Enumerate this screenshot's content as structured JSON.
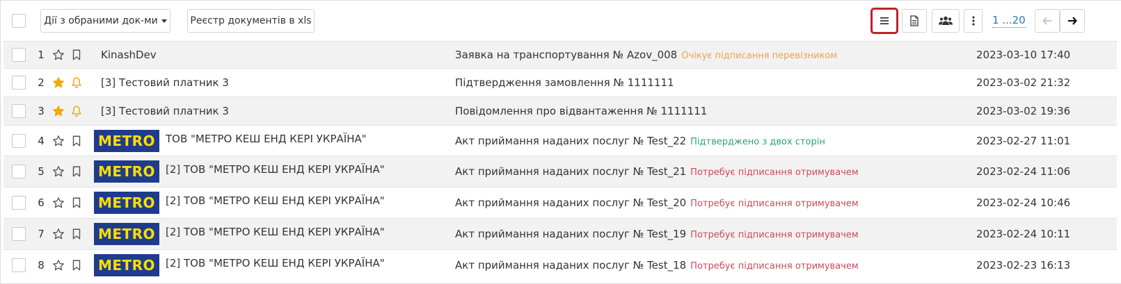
{
  "toolbar": {
    "bulk_actions_label": "Дії з обраними док-ми",
    "export_label": "Реєстр документів в xls",
    "pagination_label": "1 ...20"
  },
  "colors": {
    "status_pending": "#f0a24a",
    "status_confirmed": "#27a86f",
    "status_needs_sign": "#cc4a5a",
    "star_active": "#f2a900",
    "active_button_outline": "#c0202e",
    "link": "#2a7ab8",
    "metro_blue": "#1f3c8c",
    "metro_yellow": "#ffde00"
  },
  "rows": [
    {
      "num": "1",
      "starred": false,
      "bell": false,
      "logo": false,
      "sender": "KinashDev",
      "doc": "Заявка на транспортування № Azov_008",
      "status": "Очікує підписання перевізником",
      "status_type": "pending",
      "date": "2023-03-10 17:40"
    },
    {
      "num": "2",
      "starred": true,
      "bell": true,
      "logo": false,
      "sender": "[3] Тестовий платник 3",
      "doc": "Підтвердження замовлення № 1111111",
      "status": "",
      "status_type": "",
      "date": "2023-03-02 21:32"
    },
    {
      "num": "3",
      "starred": true,
      "bell": true,
      "logo": false,
      "sender": "[3] Тестовий платник 3",
      "doc": "Повідомлення про відвантаження № 1111111",
      "status": "",
      "status_type": "",
      "date": "2023-03-02 19:36"
    },
    {
      "num": "4",
      "starred": false,
      "bell": false,
      "logo": true,
      "logo_text": "METRO",
      "sender": "ТОВ \"МЕТРО КЕШ ЕНД КЕРІ УКРАЇНА\"",
      "doc": "Акт приймання наданих послуг № Test_22",
      "status": "Підтверджено з двох сторін",
      "status_type": "confirmed",
      "date": "2023-02-27 11:01"
    },
    {
      "num": "5",
      "starred": false,
      "bell": false,
      "logo": true,
      "logo_text": "METRO",
      "sender": "[2] ТОВ \"МЕТРО КЕШ ЕНД КЕРІ УКРАЇНА\"",
      "doc": "Акт приймання наданих послуг № Test_21",
      "status": "Потребує підписання отримувачем",
      "status_type": "needs_sign",
      "date": "2023-02-24 11:06"
    },
    {
      "num": "6",
      "starred": false,
      "bell": false,
      "logo": true,
      "logo_text": "METRO",
      "sender": "[2] ТОВ \"МЕТРО КЕШ ЕНД КЕРІ УКРАЇНА\"",
      "doc": "Акт приймання наданих послуг № Test_20",
      "status": "Потребує підписання отримувачем",
      "status_type": "needs_sign",
      "date": "2023-02-24 10:46"
    },
    {
      "num": "7",
      "starred": false,
      "bell": false,
      "logo": true,
      "logo_text": "METRO",
      "sender": "[2] ТОВ \"МЕТРО КЕШ ЕНД КЕРІ УКРАЇНА\"",
      "doc": "Акт приймання наданих послуг № Test_19",
      "status": "Потребує підписання отримувачем",
      "status_type": "needs_sign",
      "date": "2023-02-24 10:11"
    },
    {
      "num": "8",
      "starred": false,
      "bell": false,
      "logo": true,
      "logo_text": "METRO",
      "sender": "[2] ТОВ \"МЕТРО КЕШ ЕНД КЕРІ УКРАЇНА\"",
      "doc": "Акт приймання наданих послуг № Test_18",
      "status": "Потребує підписання отримувачем",
      "status_type": "needs_sign",
      "date": "2023-02-23 16:13"
    }
  ]
}
